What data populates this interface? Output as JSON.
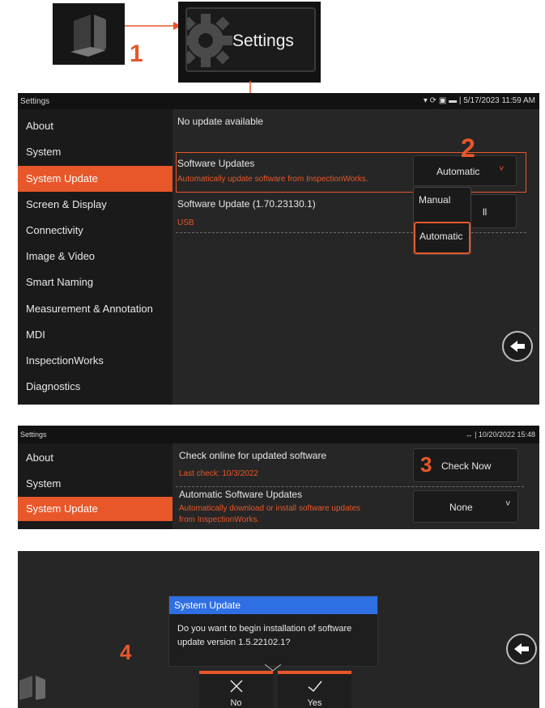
{
  "callouts": {
    "step1": "1",
    "step2": "2",
    "step3": "3",
    "step4": "4"
  },
  "launcher": {
    "settings_tile_label": "Settings",
    "app_icon": "app-logo-icon",
    "gear_icon": "gear-icon"
  },
  "screen1": {
    "status": {
      "title": "Settings",
      "datetime": "5/17/2023  11:59 AM",
      "icons": [
        "wifi-icon",
        "sync-icon",
        "battery-charging-icon",
        "battery-icon"
      ]
    },
    "sidebar": [
      "About",
      "System",
      "System Update",
      "Screen & Display",
      "Connectivity",
      "Image & Video",
      "Smart Naming",
      "Measurement & Annotation",
      "MDI",
      "InspectionWorks",
      "Diagnostics"
    ],
    "active_item": "System Update",
    "no_update_text": "No update available",
    "software_updates": {
      "label": "Software Updates",
      "description": "Automatically update software from InspectionWorks.",
      "selected": "Automatic",
      "options": [
        "Manual",
        "Automatic"
      ]
    },
    "software_update_usb": {
      "label": "Software Update (1.70.23130.1)",
      "source": "USB",
      "button_partial": "ll"
    }
  },
  "screen2": {
    "status": {
      "title": "Settings",
      "datetime": "10/20/2022 15:48"
    },
    "sidebar": [
      "About",
      "System",
      "System Update"
    ],
    "check_online": {
      "label": "Check online for updated software",
      "last_check": "Last check: 10/3/2022",
      "button": "Check Now"
    },
    "automatic_updates": {
      "label": "Automatic Software Updates",
      "description_line1": "Automatically download or install software updates",
      "description_line2": "from InspectionWorks.",
      "selected": "None"
    }
  },
  "screen3": {
    "dialog": {
      "title": "System Update",
      "message_line1": "Do you want to begin installation of software",
      "message_line2": "update version 1.5.22102.1?"
    },
    "buttons": {
      "no": "No",
      "yes": "Yes"
    }
  },
  "colors": {
    "accent": "#e8572a",
    "dialog_title": "#2f6fe4",
    "background": "#262626",
    "sidebar": "#1a1a1a"
  }
}
